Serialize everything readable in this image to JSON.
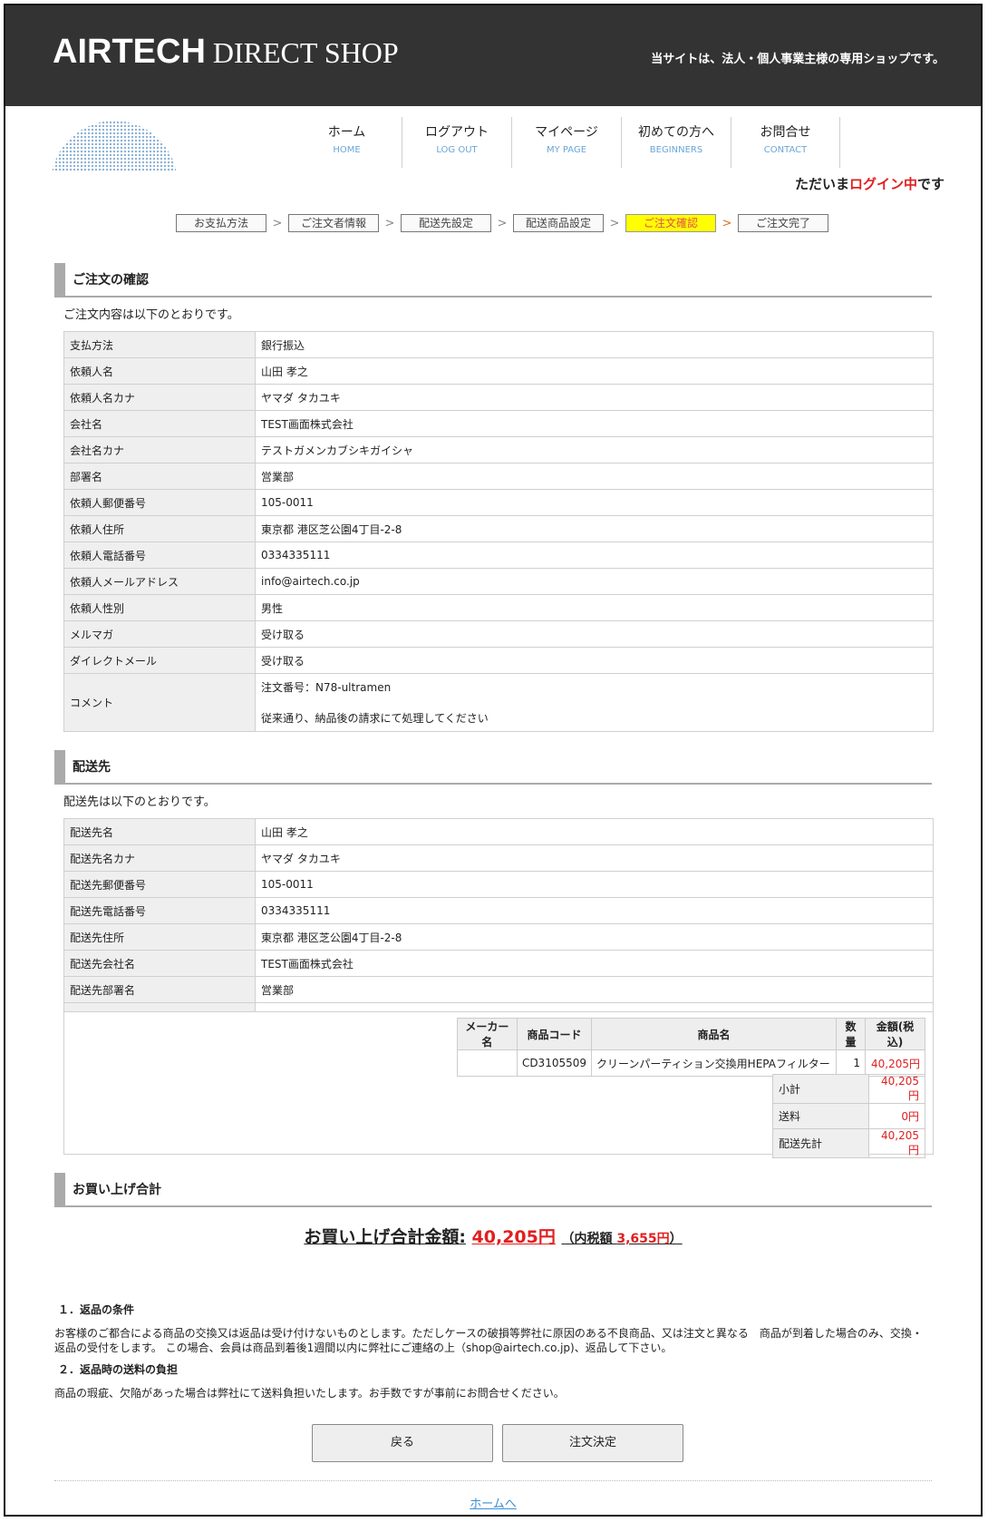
{
  "header": {
    "brand_bold": "AIRTECH",
    "brand_serif": "DIRECT SHOP",
    "tagline": "当サイトは、法人・個人事業主様の専用ショップです。"
  },
  "nav": [
    {
      "jp": "ホーム",
      "en": "HOME"
    },
    {
      "jp": "ログアウト",
      "en": "LOG OUT"
    },
    {
      "jp": "マイページ",
      "en": "MY PAGE"
    },
    {
      "jp": "初めての方へ",
      "en": "BEGINNERS"
    },
    {
      "jp": "お問合せ",
      "en": "CONTACT"
    }
  ],
  "login_msg": {
    "pre": "ただいま",
    "highlight": "ログイン中",
    "post": "です"
  },
  "steps": [
    "お支払方法",
    "ご注文者情報",
    "配送先設定",
    "配送商品設定",
    "ご注文確認",
    "ご注文完了"
  ],
  "step_sep": ">",
  "order": {
    "title": "ご注文の確認",
    "lead": "ご注文内容は以下のとおりです。",
    "rows": [
      {
        "k": "支払方法",
        "v": "銀行振込"
      },
      {
        "k": "依頼人名",
        "v": "山田 孝之"
      },
      {
        "k": "依頼人名カナ",
        "v": "ヤマダ タカユキ"
      },
      {
        "k": "会社名",
        "v": "TEST画面株式会社"
      },
      {
        "k": "会社名カナ",
        "v": "テストガメンカブシキガイシャ"
      },
      {
        "k": "部署名",
        "v": "営業部"
      },
      {
        "k": "依頼人郵便番号",
        "v": "105-0011"
      },
      {
        "k": "依頼人住所",
        "v": "東京都 港区芝公園4丁目-2-8"
      },
      {
        "k": "依頼人電話番号",
        "v": "0334335111"
      },
      {
        "k": "依頼人メールアドレス",
        "v": "info@airtech.co.jp"
      },
      {
        "k": "依頼人性別",
        "v": "男性"
      },
      {
        "k": "メルマガ",
        "v": "受け取る"
      },
      {
        "k": "ダイレクトメール",
        "v": "受け取る"
      }
    ],
    "comment_label": "コメント",
    "comment_line1": "注文番号：N78-ultramen",
    "comment_line2": "従来通り、納品後の請求にて処理してください"
  },
  "delivery": {
    "title": "配送先",
    "lead": "配送先は以下のとおりです。",
    "rows": [
      {
        "k": "配送先名",
        "v": "山田 孝之"
      },
      {
        "k": "配送先名カナ",
        "v": "ヤマダ タカユキ"
      },
      {
        "k": "配送先郵便番号",
        "v": "105-0011"
      },
      {
        "k": "配送先電話番号",
        "v": "0334335111"
      },
      {
        "k": "配送先住所",
        "v": "東京都 港区芝公園4丁目-2-8"
      },
      {
        "k": "配送先会社名",
        "v": "TEST画面株式会社"
      },
      {
        "k": "配送先部署名",
        "v": "営業部"
      }
    ],
    "items_header": {
      "maker": "メーカー名",
      "code": "商品コード",
      "name": "商品名",
      "qty": "数量",
      "price": "金額(税込)"
    },
    "items": [
      {
        "maker": "",
        "code": "CD3105509",
        "name": "クリーンパーティション交換用HEPAフィルター",
        "qty": "1",
        "price": "40,205円"
      }
    ],
    "subtotal_label": "小計",
    "subtotal": "40,205円",
    "shipping_label": "送料",
    "shipping": "0円",
    "dest_total_label": "配送先計",
    "dest_total": "40,205円"
  },
  "total": {
    "title": "お買い上げ合計",
    "label": "お買い上げ合計金額:",
    "amount": "40,205円",
    "tax_label": "（内税額",
    "tax": "3,655円",
    "tax_close": "）"
  },
  "notes": {
    "h1": "１．返品の条件",
    "p1": "お客様のご都合による商品の交換又は返品は受け付けないものとします。ただしケースの破損等弊社に原因のある不良商品、又は注文と異なる　商品が到着した場合のみ、交換・返品の受付をします。 この場合、会員は商品到着後1週間以内に弊社にご連絡の上（shop@airtech.co.jp)、返品して下さい。",
    "h2": "２．返品時の送料の負担",
    "p2": "商品の瑕疵、欠陥があった場合は弊社にて送料負担いたします。お手数ですが事前にお問合せください。"
  },
  "buttons": {
    "back": "戻る",
    "confirm": "注文決定"
  },
  "home_link": "ホームへ"
}
